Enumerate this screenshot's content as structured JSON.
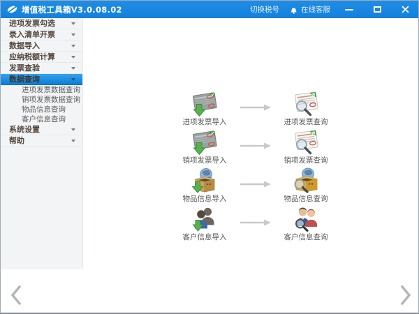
{
  "window": {
    "title": "增值税工具箱V3.0.08.02",
    "switch_tax_label": "切换税号",
    "online_service_label": "在线客服",
    "controls": {
      "minimize": "minimize",
      "maximize": "maximize",
      "close": "close"
    }
  },
  "icons": {
    "app_logo": "leaf-badge-icon",
    "online_service": "bell-icon",
    "menu_caret": "chevron-down-icon",
    "flow_arrow": "arrow-right-icon",
    "pager_prev": "chevron-left-icon",
    "pager_next": "chevron-right-icon",
    "flow_row_icons": [
      {
        "source": "invoice-import-icon",
        "target": "invoice-search-icon"
      },
      {
        "source": "invoice-import-icon",
        "target": "invoice-search-icon"
      },
      {
        "source": "goods-box-import-icon",
        "target": "goods-box-search-icon"
      },
      {
        "source": "customers-import-icon",
        "target": "customers-search-icon"
      }
    ]
  },
  "colors": {
    "titlebar_blue": "#1787e0",
    "selected_menu_blue": "#1e8fe4",
    "sidebar_bg": "#f3f4f6",
    "accent_green": "#55b14e",
    "stamp_red": "#c65b4e",
    "arrow_gray": "#c9c9c9",
    "menu_text": "#52483e"
  },
  "sidebar": {
    "items": [
      {
        "label": "进项发票勾选",
        "selected": false
      },
      {
        "label": "录入清单开票",
        "selected": false
      },
      {
        "label": "数据导入",
        "selected": false
      },
      {
        "label": "应纳税额计算",
        "selected": false
      },
      {
        "label": "发票查验",
        "selected": false
      },
      {
        "label": "数据查询",
        "selected": true
      },
      {
        "label": "系统设置",
        "selected": false
      },
      {
        "label": "帮助",
        "selected": false
      }
    ],
    "submenu_of_selected": [
      "进项发票数据查询",
      "销项发票数据查询",
      "物品信息查询",
      "客户信息查询"
    ]
  },
  "main": {
    "rows": [
      {
        "source": "进项发票导入",
        "target": "进项发票查询"
      },
      {
        "source": "销项发票导入",
        "target": "销项发票查询"
      },
      {
        "source": "物品信息导入",
        "target": "物品信息查询"
      },
      {
        "source": "客户信息导入",
        "target": "客户信息查询"
      }
    ]
  }
}
